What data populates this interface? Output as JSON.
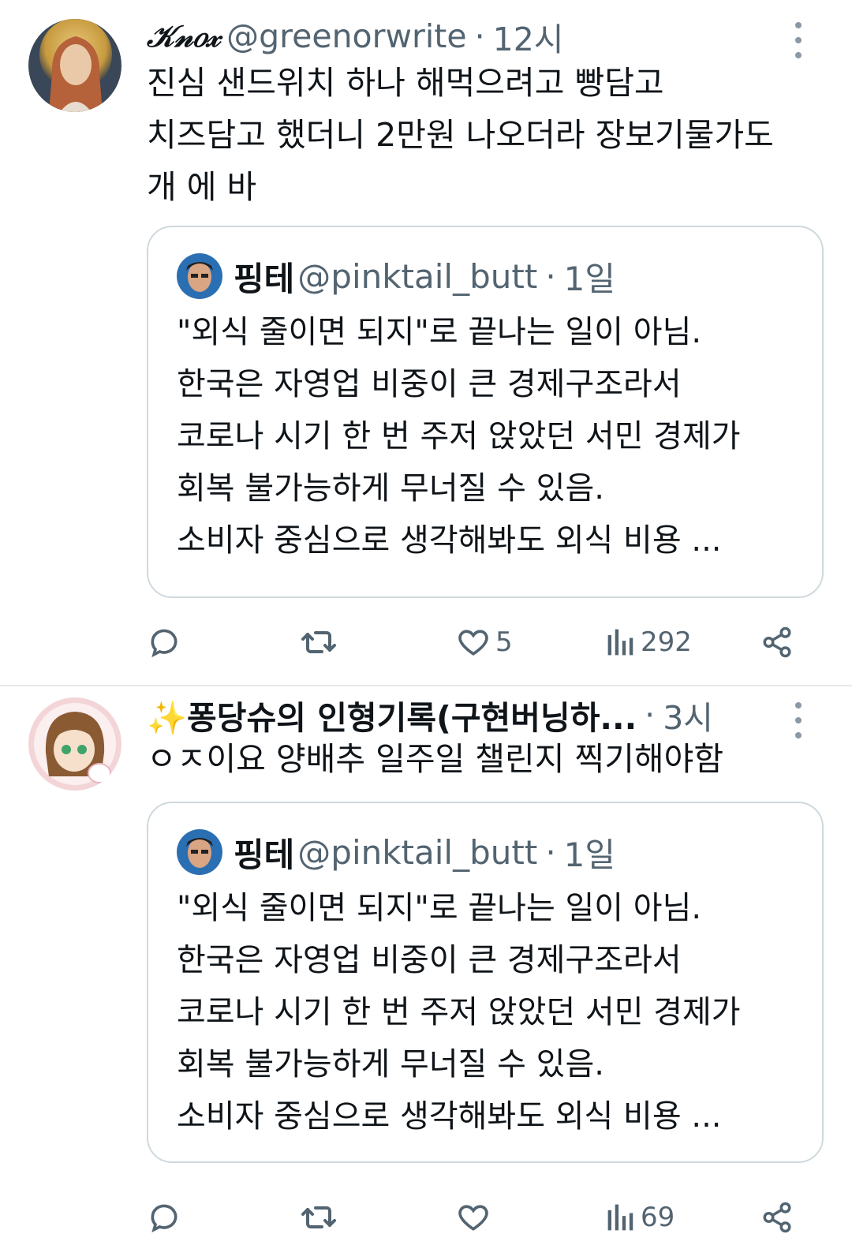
{
  "colors": {
    "text": "#0f1419",
    "secondary": "#536471",
    "border": "#cfd9de",
    "divider": "#e7e9ea"
  },
  "tweets": [
    {
      "display_name": "𝒦𝓃𝑜𝓍",
      "handle": "@greenorwrite",
      "separator": "·",
      "time": "12시",
      "text": "진심 샌드위치 하나 해먹으려고 빵담고\n치즈담고 했더니 2만원 나오더라 장보기물가도\n개 에 바",
      "quote": {
        "display_name": "핑테",
        "handle": "@pinktail_butt",
        "separator": "·",
        "time": "1일",
        "text": "\"외식 줄이면 되지\"로 끝나는 일이 아님.\n한국은 자영업 비중이 큰 경제구조라서\n코로나 시기 한 번 주저 앉았던 서민 경제가\n회복 불가능하게 무너질 수 있음.\n소비자 중심으로 생각해봐도 외식 비용 ..."
      },
      "stats": {
        "likes": "5",
        "views": "292"
      },
      "icons": [
        "reply-icon",
        "retweet-icon",
        "like-icon",
        "views-icon",
        "share-icon",
        "more-icon"
      ]
    },
    {
      "display_name": "✨퐁당슈의 인형기록(구현버닝하...",
      "separator": "·",
      "time": "3시",
      "text": "ㅇㅈ이요 양배추 일주일 챌린지 찍기해야함",
      "quote": {
        "display_name": "핑테",
        "handle": "@pinktail_butt",
        "separator": "·",
        "time": "1일",
        "text": "\"외식 줄이면 되지\"로 끝나는 일이 아님.\n한국은 자영업 비중이 큰 경제구조라서\n코로나 시기 한 번 주저 앉았던 서민 경제가\n회복 불가능하게 무너질 수 있음.\n소비자 중심으로 생각해봐도 외식 비용 ..."
      },
      "stats": {
        "views": "69"
      },
      "icons": [
        "reply-icon",
        "retweet-icon",
        "like-icon",
        "views-icon",
        "share-icon",
        "more-icon"
      ]
    }
  ]
}
